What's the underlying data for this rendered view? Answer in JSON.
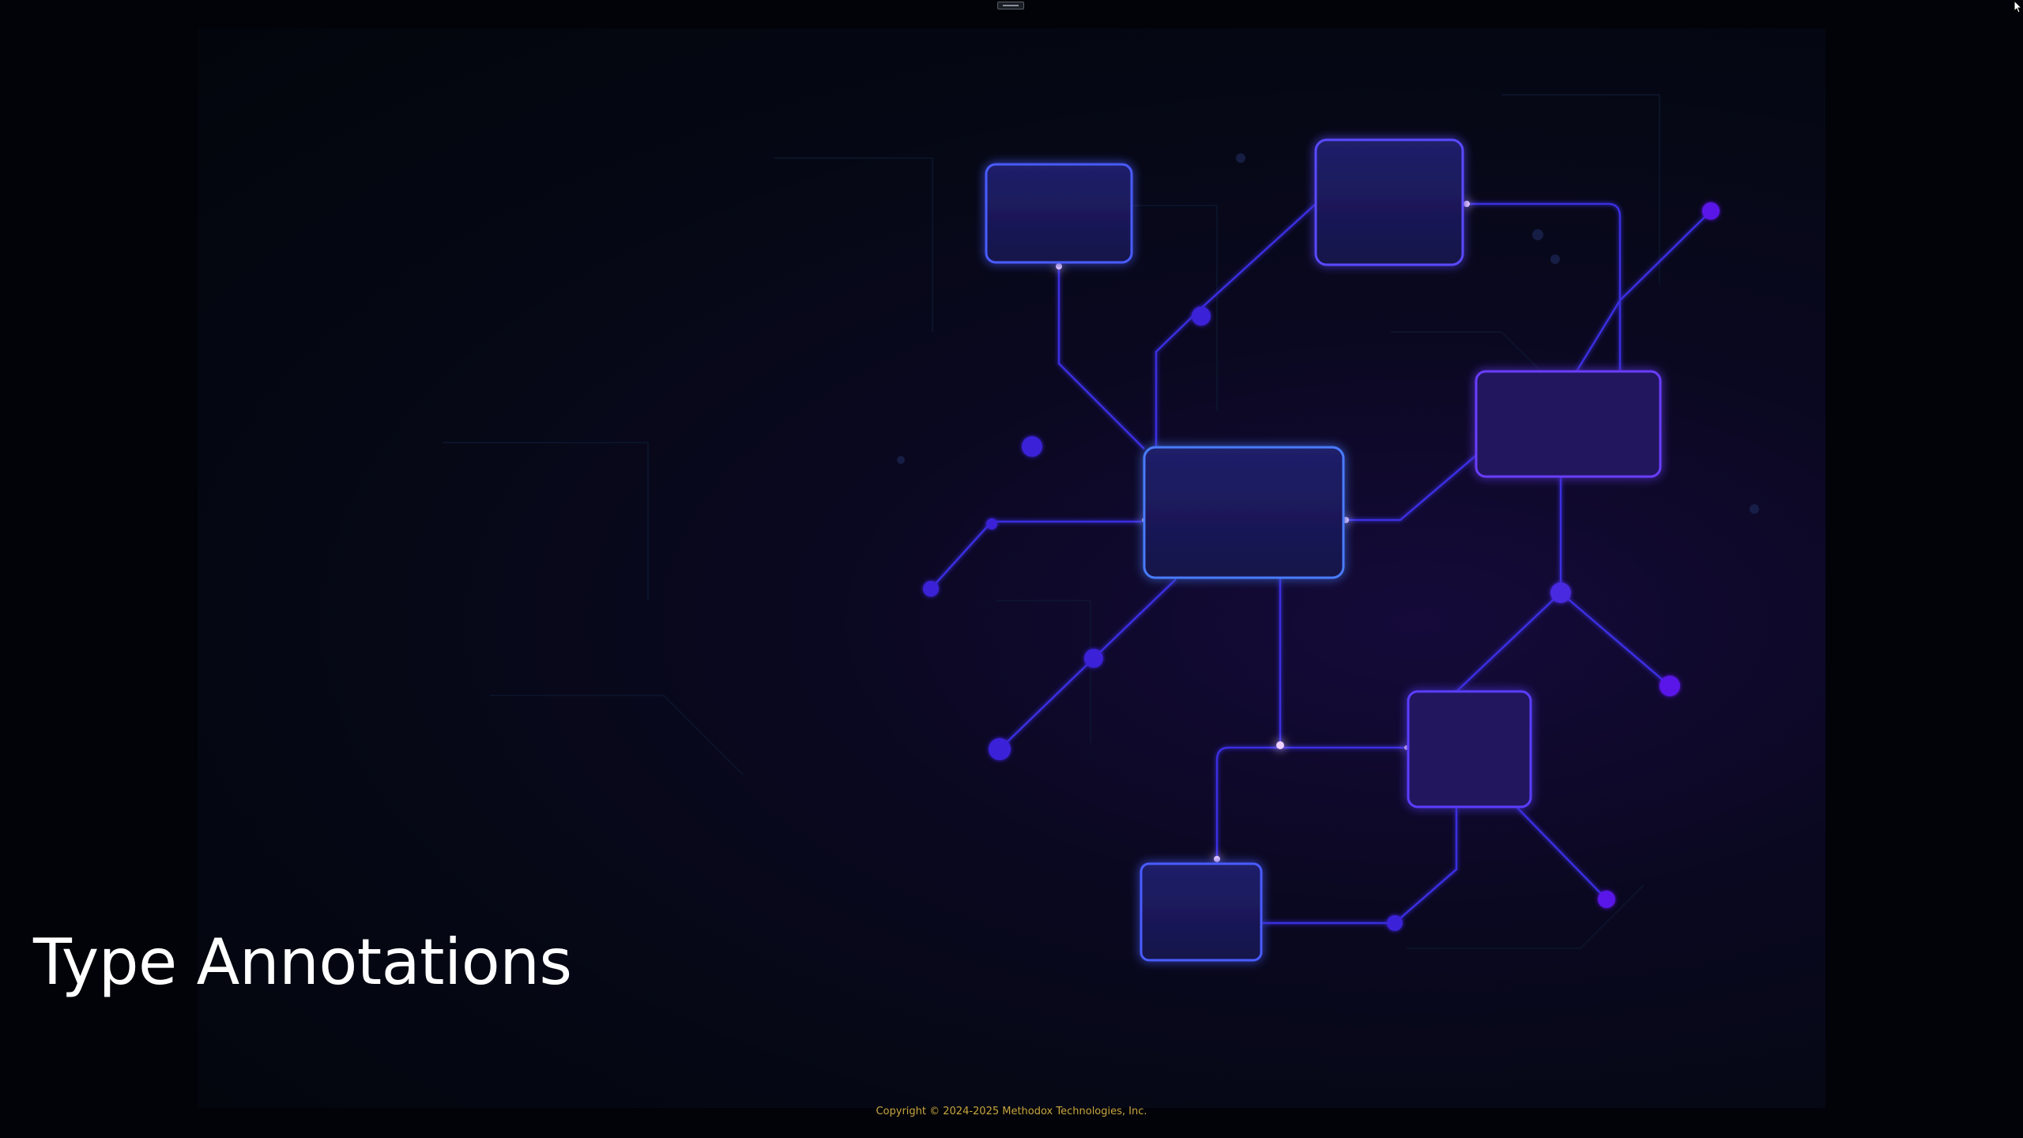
{
  "slide": {
    "title": "Type Annotations"
  },
  "footer": {
    "copyright": "Copyright © 2024-2025 Methodox Technologies, Inc."
  },
  "icons": {
    "top_handle": "window-drag-handle-icon",
    "cursor": "mouse-pointer-icon"
  },
  "colors": {
    "background": "#020308",
    "node_fill": "#1a1a55",
    "node_stroke_blue": "#4a5cff",
    "node_stroke_purple": "#6a3cff",
    "link": "#3b2fe0",
    "dot": "#3a22d8",
    "footer_text": "#c9a640",
    "title_text": "#ffffff"
  }
}
